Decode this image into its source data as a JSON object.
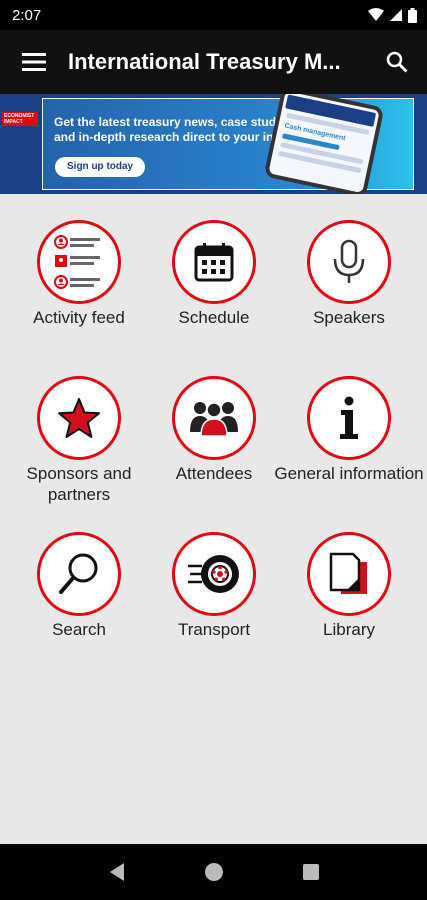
{
  "status_bar": {
    "time": "2:07",
    "icons": [
      "wifi-icon",
      "signal-icon",
      "battery-icon"
    ]
  },
  "app_bar": {
    "title": "International Treasury M...",
    "menu_icon": "hamburger-menu-icon",
    "search_icon": "search-icon"
  },
  "banner": {
    "tag": "ECONOMIST IMPACT",
    "headline": "Get the latest treasury news, case studies and in-depth research direct to your inbox",
    "cta": "Sign up today",
    "phone_text": "Cash management"
  },
  "tiles": [
    {
      "label": "Activity feed",
      "icon": "activity-feed-icon"
    },
    {
      "label": "Schedule",
      "icon": "calendar-icon"
    },
    {
      "label": "Speakers",
      "icon": "microphone-icon"
    },
    {
      "label": "Sponsors and partners",
      "icon": "star-icon"
    },
    {
      "label": "Attendees",
      "icon": "people-icon"
    },
    {
      "label": "General information",
      "icon": "info-icon"
    },
    {
      "label": "Search",
      "icon": "magnifier-icon"
    },
    {
      "label": "Transport",
      "icon": "wheel-icon"
    },
    {
      "label": "Library",
      "icon": "document-icon"
    }
  ],
  "nav_bar": {
    "back_icon": "back-icon",
    "home_icon": "home-icon",
    "recents_icon": "recents-icon"
  },
  "colors": {
    "accent": "#e30613",
    "app_bar": "#111111",
    "background": "#e8e8e8",
    "banner_blue": "#1b3f86"
  }
}
